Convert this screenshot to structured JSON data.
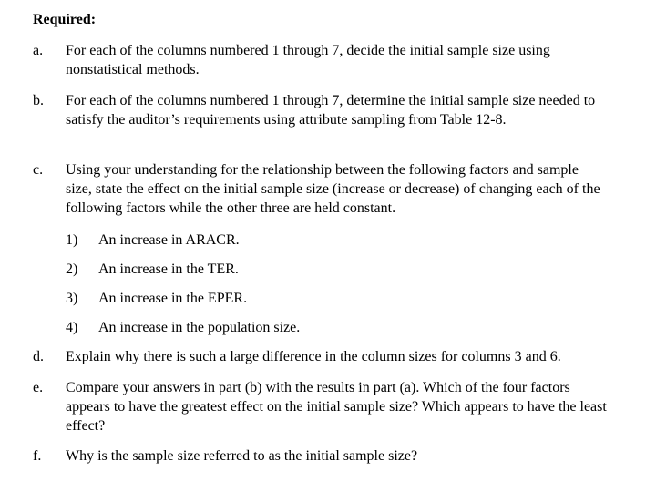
{
  "heading": "Required:",
  "items": [
    {
      "label": "a.",
      "text": "For each of the columns numbered 1 through 7, decide the initial sample size using nonstatistical methods."
    },
    {
      "label": "b.",
      "text": "For each of the columns numbered 1 through 7, determine the initial sample size needed to satisfy the auditor’s requirements using attribute sampling from  Table 12-8."
    },
    {
      "label": "c.",
      "text": "Using your understanding for the relationship between the following factors and sample size, state the effect on the initial sample size (increase or decrease) of changing each of the following factors while the other three are held constant.",
      "subitems": [
        {
          "num": "1)",
          "text": "An increase in ARACR."
        },
        {
          "num": "2)",
          "text": "An increase in the TER."
        },
        {
          "num": "3)",
          "text": "An increase in the EPER."
        },
        {
          "num": "4)",
          "text": "An increase in the population size."
        }
      ]
    },
    {
      "label": "d.",
      "text": "Explain why there is such a large difference in the column sizes for columns 3 and 6."
    },
    {
      "label": "e.",
      "text": "Compare your answers in part (b) with the results in part (a). Which of the four factors appears to have the greatest effect on the initial sample size? Which appears to have the least effect?"
    },
    {
      "label": "f.",
      "text": "Why is the sample size referred to as the initial sample size?"
    }
  ]
}
